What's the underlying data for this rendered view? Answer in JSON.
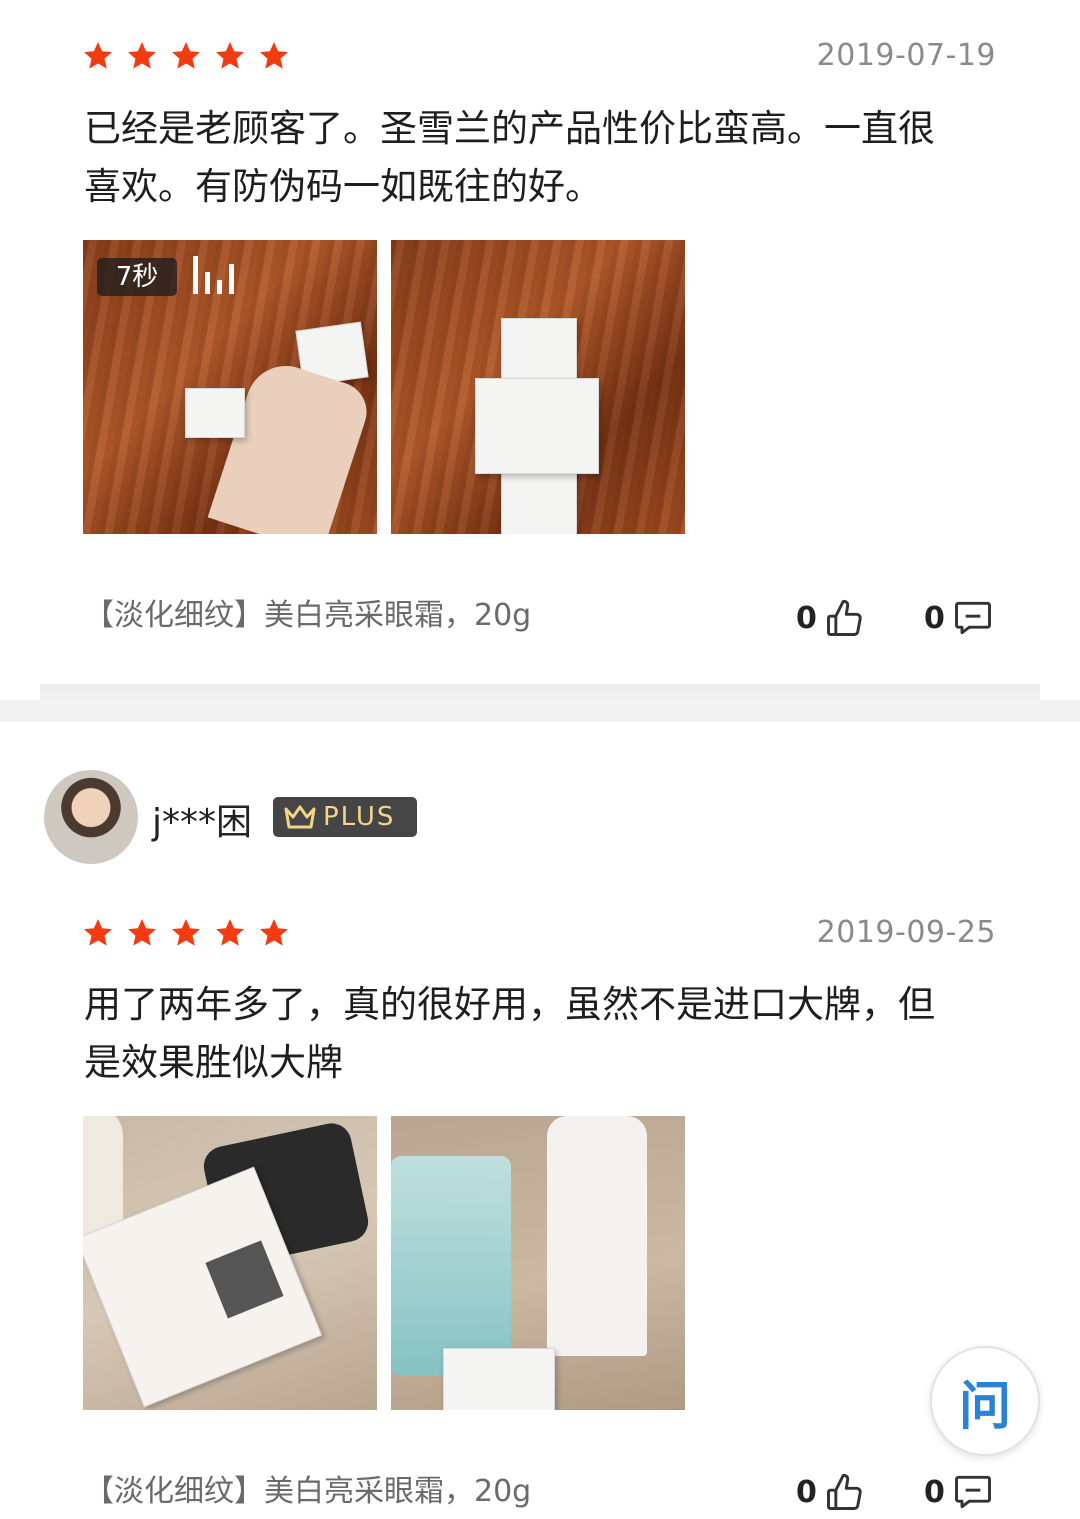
{
  "review1": {
    "rating": 5,
    "date": "2019-07-19",
    "text_line1": "已经是老顾客了。圣雪兰的产品性价比蛮高。一直很",
    "text_line2": "喜欢。有防伪码一如既往的好。",
    "video_duration": "7秒",
    "spec": "【淡化细纹】美白亮采眼霜，20g",
    "likes": "0",
    "comments": "0"
  },
  "review2": {
    "user": "j***困",
    "badge": "PLUS",
    "rating": 5,
    "date": "2019-09-25",
    "text_line1": "用了两年多了，真的很好用，虽然不是进口大牌，但",
    "text_line2": "是效果胜似大牌",
    "spec": "【淡化细纹】美白亮采眼霜，20g",
    "likes": "0",
    "comments": "0"
  },
  "ask_button": "问",
  "colors": {
    "star": "#f23b12",
    "accent": "#2a82d8",
    "badge_bg": "#454545",
    "badge_text": "#f3d58a"
  },
  "icons": [
    "star-icon",
    "thumbs-up-icon",
    "comment-icon",
    "crown-icon",
    "audio-bars-icon"
  ]
}
